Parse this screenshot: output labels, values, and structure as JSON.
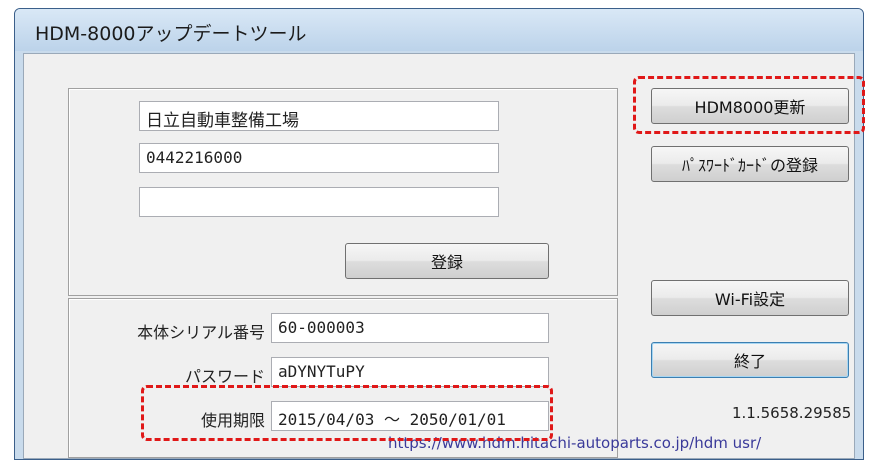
{
  "window": {
    "title": "HDM-8000アップデートツール"
  },
  "registration": {
    "company_name": "日立自動車整備工場",
    "phone": "0442216000",
    "extra": "",
    "register_button": "登録"
  },
  "device_info": {
    "serial_label": "本体シリアル番号",
    "serial_value": "60-000003",
    "password_label": "パスワード",
    "password_value": "aDYNYTuPY",
    "period_label": "使用期限",
    "period_value": "2015/04/03 ～ 2050/01/01"
  },
  "buttons": {
    "update": "HDM8000更新",
    "password_card": "ﾊﾟｽﾜｰﾄﾞｶｰﾄﾞの登録",
    "wifi": "Wi-Fi設定",
    "exit": "終了"
  },
  "version": "1.1.5658.29585",
  "url": "https://www.hdm.hitachi-autoparts.co.jp/hdm usr/",
  "highlight_color": "#e01818"
}
